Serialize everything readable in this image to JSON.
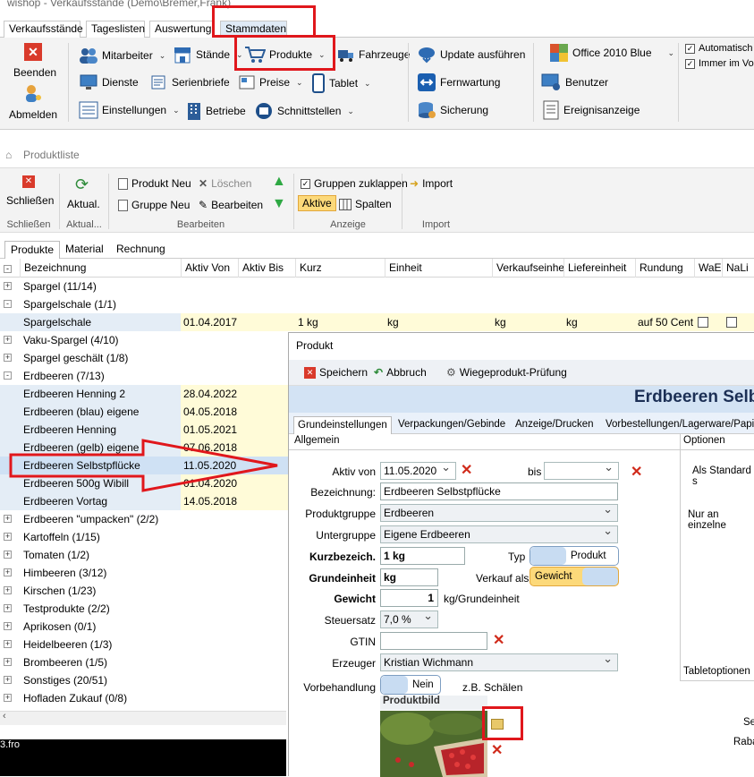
{
  "window": {
    "title": "wishop - Verkaufsstände (Demo\\Bremer,Frank)"
  },
  "menu_tabs": [
    "Verkaufsstände",
    "Tageslisten",
    "Auswertung",
    "Stammdaten"
  ],
  "ribbon": {
    "beenden": "Beenden",
    "abmelden": "Abmelden",
    "mitarbeiter": "Mitarbeiter",
    "staende": "Stände",
    "produkte": "Produkte",
    "fahrzeuge": "Fahrzeuge",
    "dienste": "Dienste",
    "serienbriefe": "Serienbriefe",
    "preise": "Preise",
    "tablet": "Tablet",
    "einstellungen": "Einstellungen",
    "betriebe": "Betriebe",
    "schnittstellen": "Schnittstellen",
    "update": "Update ausführen",
    "fernwartung": "Fernwartung",
    "sicherung": "Sicherung",
    "theme": "Office 2010 Blue",
    "benutzer": "Benutzer",
    "ereignis": "Ereignisanzeige",
    "automatisch": "Automatisch",
    "immer": "Immer im Vor"
  },
  "produktliste": {
    "title": "Produktliste",
    "schliessen": "Schließen",
    "aktual": "Aktual.",
    "produkt_neu": "Produkt Neu",
    "loeschen": "Löschen",
    "gruppe_neu": "Gruppe Neu",
    "bearbeiten": "Bearbeiten",
    "gruppen_zuklappen": "Gruppen zuklappen",
    "aktive": "Aktive",
    "spalten": "Spalten",
    "import": "Import",
    "groups": [
      "Schließen",
      "Aktual...",
      "Bearbeiten",
      "Anzeige",
      "Import"
    ],
    "tabs": [
      "Produkte",
      "Material",
      "Rechnung"
    ]
  },
  "grid": {
    "columns": [
      "Bezeichnung",
      "Aktiv Von",
      "Aktiv Bis",
      "Kurz",
      "Einheit",
      "Verkaufseinheit",
      "Liefereinheit",
      "Rundung",
      "WaEi",
      "NaLi"
    ],
    "rows": [
      {
        "name": "Spargel (11/14)",
        "exp": "+"
      },
      {
        "name": "Spargelschale (1/1)",
        "exp": "-"
      },
      {
        "name": "Spargelschale",
        "von": "01.04.2017",
        "kurz": "1 kg",
        "einheit": "kg",
        "ve": "kg",
        "le": "kg",
        "rundung": "auf 50 Cent"
      },
      {
        "name": "Vaku-Spargel (4/10)",
        "exp": "+"
      },
      {
        "name": "Spargel geschält (1/8)",
        "exp": "+"
      },
      {
        "name": "Erdbeeren (7/13)",
        "exp": "-"
      },
      {
        "name": "Erdbeeren Henning 2",
        "von": "28.04.2022"
      },
      {
        "name": "Erdbeeren (blau) eigene",
        "von": "04.05.2018"
      },
      {
        "name": "Erdbeeren Henning",
        "von": "01.05.2021"
      },
      {
        "name": "Erdbeeren (gelb) eigene",
        "von": "07.06.2018"
      },
      {
        "name": "Erdbeeren Selbstpflücke",
        "von": "11.05.2020"
      },
      {
        "name": "Erdbeeren 500g Wibill",
        "von": "01.04.2020"
      },
      {
        "name": "Erdbeeren Vortag",
        "von": "14.05.2018"
      },
      {
        "name": "Erdbeeren \"umpacken\" (2/2)",
        "exp": "+"
      },
      {
        "name": "Kartoffeln (1/15)",
        "exp": "+"
      },
      {
        "name": "Tomaten (1/2)",
        "exp": "+"
      },
      {
        "name": "Himbeeren (3/12)",
        "exp": "+"
      },
      {
        "name": "Kirschen (1/23)",
        "exp": "+"
      },
      {
        "name": "Testprodukte (2/2)",
        "exp": "+"
      },
      {
        "name": "Aprikosen (0/1)",
        "exp": "+"
      },
      {
        "name": "Heidelbeeren (1/3)",
        "exp": "+"
      },
      {
        "name": "Brombeeren (1/5)",
        "exp": "+"
      },
      {
        "name": "Sonstiges (20/51)",
        "exp": "+"
      },
      {
        "name": "Hofladen Zukauf (0/8)",
        "exp": "+"
      }
    ]
  },
  "bottom": {
    "text": "3.fro"
  },
  "dialog": {
    "title": "Produkt",
    "speichern": "Speichern",
    "abbruch": "Abbruch",
    "wiege": "Wiegeprodukt-Prüfung",
    "heading": "Erdbeeren Selbs",
    "tabs": [
      "Grundeinstellungen",
      "Verpackungen/Gebinde",
      "Anzeige/Drucken",
      "Vorbestellungen/Lagerware/Papierk"
    ],
    "allgemein": "Allgemein",
    "optionen": "Optionen",
    "aktiv_von_label": "Aktiv von",
    "aktiv_von": "11.05.2020",
    "bis_label": "bis",
    "bezeichnung_label": "Bezeichnung:",
    "bezeichnung": "Erdbeeren Selbstpflücke",
    "produktgruppe_label": "Produktgruppe",
    "produktgruppe": "Erdbeeren",
    "untergruppe_label": "Untergruppe",
    "untergruppe": "Eigene Erdbeeren",
    "kurz_label": "Kurzbezeich.",
    "kurz": "1 kg",
    "typ_label": "Typ",
    "typ": "Produkt",
    "grundeinheit_label": "Grundeinheit",
    "grundeinheit": "kg",
    "verkauf_label": "Verkauf als",
    "verkauf": "Gewicht",
    "gewicht_label": "Gewicht",
    "gewicht": "1",
    "gewicht_unit": "kg/Grundeinheit",
    "steuer_label": "Steuersatz",
    "steuer": "7,0 %",
    "gtin_label": "GTIN",
    "gtin": "",
    "erzeuger_label": "Erzeuger",
    "erzeuger": "Kristian Wichmann",
    "vorbehandlung_label": "Vorbehandlung",
    "vorbehandlung": "Nein",
    "zb": "z.B. Schälen",
    "produktbild": "Produktbild",
    "opt1": "Als Standard s",
    "opt2": "Nur an einzelne",
    "tabletoptionen": "Tabletoptionen",
    "se": "Se",
    "raba": "Raba"
  }
}
